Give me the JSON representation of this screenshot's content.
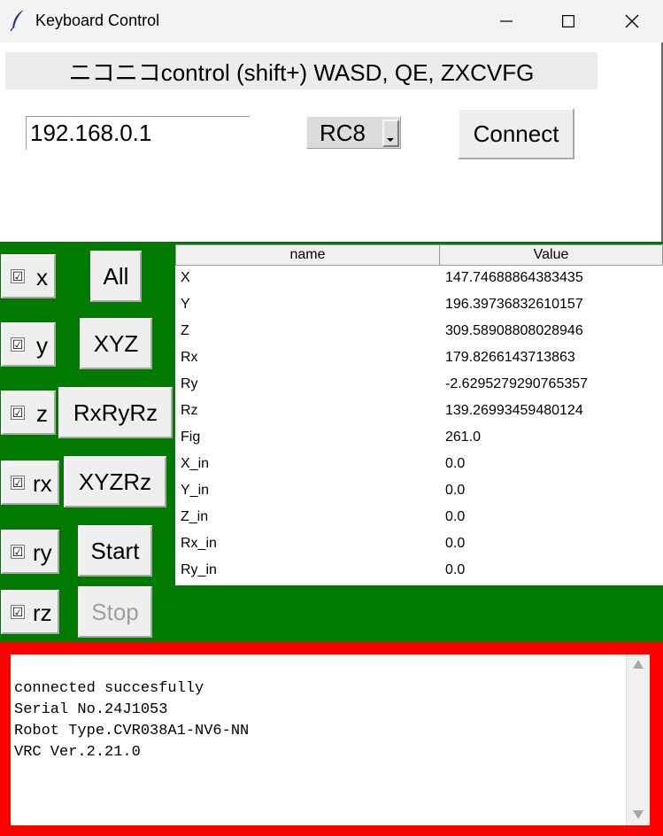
{
  "window": {
    "title": "Keyboard Control",
    "icon": "feather-icon",
    "controls": [
      "minimize-icon",
      "maximize-icon",
      "close-icon"
    ]
  },
  "header": {
    "label": "ニコニコcontrol (shift+) WASD, QE, ZXCVFG"
  },
  "connection": {
    "ip_value": "192.168.0.1",
    "controller_selected": "RC8",
    "connect_label": "Connect"
  },
  "axes": {
    "items": [
      {
        "label": "x",
        "checked": true
      },
      {
        "label": "y",
        "checked": true
      },
      {
        "label": "z",
        "checked": true
      },
      {
        "label": "rx",
        "checked": true
      },
      {
        "label": "ry",
        "checked": true
      },
      {
        "label": "rz",
        "checked": true
      }
    ],
    "check_glyph": "☑"
  },
  "buttons": {
    "all": "All",
    "xyz": "XYZ",
    "rxryrz": "RxRyRz",
    "xyzrz": "XYZRz",
    "start": "Start",
    "stop": "Stop"
  },
  "table": {
    "columns": [
      "name",
      "Value"
    ],
    "rows": [
      {
        "name": "X",
        "value": "147.74688864383435"
      },
      {
        "name": "Y",
        "value": "196.39736832610157"
      },
      {
        "name": "Z",
        "value": "309.58908808028946"
      },
      {
        "name": "Rx",
        "value": "179.8266143713863"
      },
      {
        "name": "Ry",
        "value": "-2.6295279290765357"
      },
      {
        "name": "Rz",
        "value": "139.26993459480124"
      },
      {
        "name": "Fig",
        "value": "261.0"
      },
      {
        "name": "X_in",
        "value": "0.0"
      },
      {
        "name": "Y_in",
        "value": "0.0"
      },
      {
        "name": "Z_in",
        "value": "0.0"
      },
      {
        "name": "Rx_in",
        "value": "0.0"
      },
      {
        "name": "Ry_in",
        "value": "0.0"
      }
    ]
  },
  "log": {
    "lines": [
      "connected succesfully",
      "Serial No.24J1053",
      "Robot Type.CVR038A1-NV6-NN",
      "VRC Ver.2.21.0"
    ]
  },
  "colors": {
    "panel_green": "#007a00",
    "log_border_red": "#ff0000"
  }
}
